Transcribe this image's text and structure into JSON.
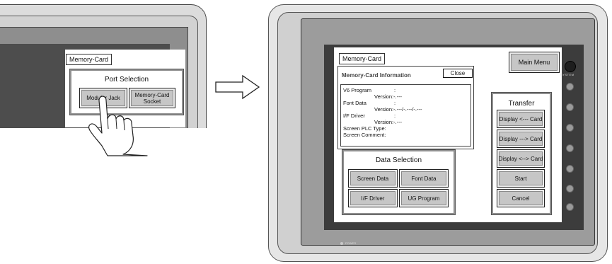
{
  "left_panel": {
    "screen_title": "Memory-Card",
    "group_title": "Port Selection",
    "buttons": [
      {
        "label": "Modular Jack"
      },
      {
        "label_line1": "Memory-Card",
        "label_line2": "Socket"
      }
    ],
    "pointer_icon": "pointing-hand-icon"
  },
  "arrow_icon": "right-arrow-icon",
  "right_panel": {
    "screen_title": "Memory-Card",
    "main_menu_label": "Main Menu",
    "info": {
      "title": "Memory-Card Information",
      "close_label": "Close",
      "lines": [
        {
          "label": "V6 Program",
          "colon": ":"
        },
        {
          "label": "Version:-.---"
        },
        {
          "label": "Font Data",
          "colon": ":"
        },
        {
          "label": "Version:-.---/-.---/-.---"
        },
        {
          "label": "I/F Driver",
          "colon": ":"
        },
        {
          "label": "Version:-.---"
        },
        {
          "label": "Screen PLC Type:"
        },
        {
          "label": "Screen Comment:"
        }
      ]
    },
    "data_selection": {
      "title": "Data Selection",
      "buttons": [
        "Screen Data",
        "Font Data",
        "I/F Driver",
        "UG Program"
      ]
    },
    "transfer": {
      "title": "Transfer",
      "buttons": [
        "Display <--- Card",
        "Display ---> Card",
        "Display <--> Card",
        "Start",
        "Cancel"
      ]
    },
    "side_keys": {
      "system_label": "SYSTEM",
      "count": 7
    },
    "power_label": "POWER"
  }
}
